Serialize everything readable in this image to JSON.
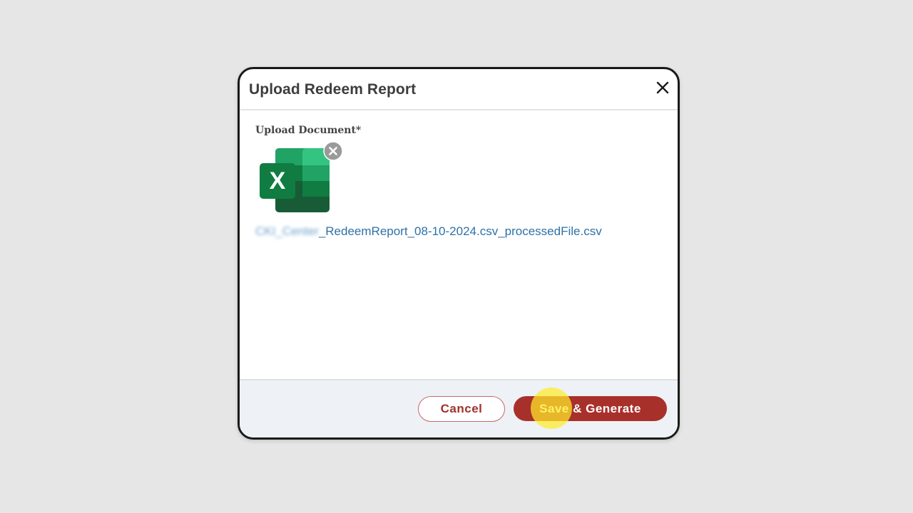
{
  "dialog": {
    "title": "Upload Redeem Report",
    "close_icon": "close-icon"
  },
  "upload": {
    "label": "Upload Document*",
    "file_icon": "excel-file-icon",
    "remove_icon": "remove-circle-icon",
    "file_name_prefix_redacted": "CKI_Center",
    "file_name": "_RedeemReport_08-10-2024.csv_processedFile.csv"
  },
  "footer": {
    "cancel_label": "Cancel",
    "save_label": "Save & Generate"
  },
  "colors": {
    "background": "#e6e6e6",
    "accent": "#a8302b",
    "link": "#2d71a8",
    "excel_green": "#1f7244",
    "click_highlight": "#ffec28"
  }
}
